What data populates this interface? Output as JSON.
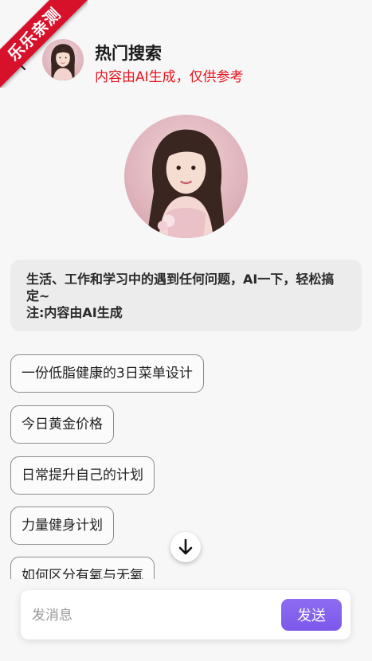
{
  "ribbon": {
    "text": "乐乐亲测"
  },
  "header": {
    "back_icon": "back-arrow-icon",
    "title": "热门搜索",
    "subtitle": "内容由AI生成，仅供参考"
  },
  "intro": {
    "line1": "生活、工作和学习中的遇到任何问题，AI一下，轻松搞定~",
    "line2": "注:内容由AI生成"
  },
  "suggestions": [
    {
      "label": "一份低脂健康的3日菜单设计"
    },
    {
      "label": "今日黄金价格"
    },
    {
      "label": "日常提升自己的计划"
    },
    {
      "label": "力量健身计划"
    },
    {
      "label": "如何区分有氧与无氧"
    }
  ],
  "scroll_button": {
    "icon": "arrow-down-icon"
  },
  "composer": {
    "placeholder": "发消息",
    "send_label": "发送"
  },
  "colors": {
    "ribbon": "#d8112b",
    "subtitle": "#e8141d",
    "send_button": "#7b58ea",
    "background": "#f8f7f8",
    "intro_card": "#ececec"
  }
}
